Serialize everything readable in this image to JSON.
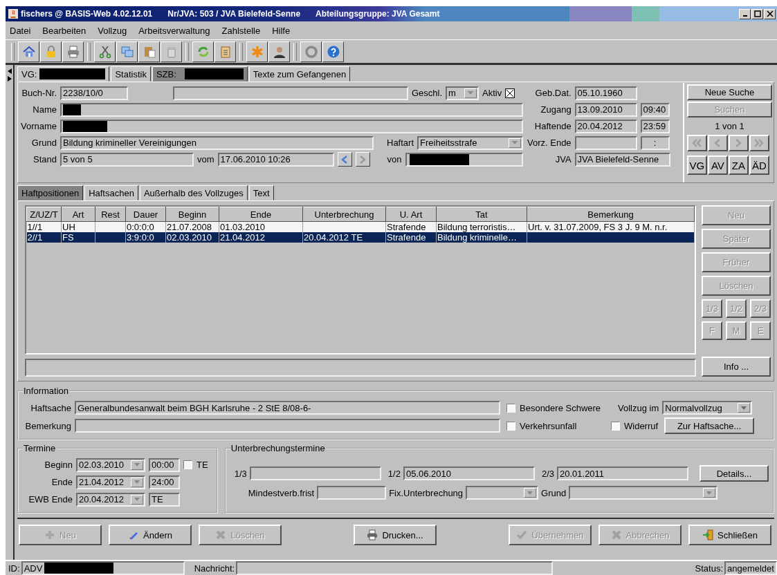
{
  "window": {
    "title_parts": [
      "fischers @ BASIS-Web 4.02.12.01",
      "Nr/JVA: 503 / JVA Bielefeld-Senne",
      "Abteilungsgruppe: JVA Gesamt"
    ]
  },
  "menu": [
    "Datei",
    "Bearbeiten",
    "Vollzug",
    "Arbeitsverwaltung",
    "Zahlstelle",
    "Hilfe"
  ],
  "record_tabs": [
    {
      "label": "VG:",
      "redacted": true,
      "selected": false
    },
    {
      "label": "Statistik",
      "selected": false
    },
    {
      "label": "SZB:",
      "redacted": true,
      "selected": true
    },
    {
      "label": "Texte zum Gefangenen",
      "selected": false
    }
  ],
  "header": {
    "buch_nr": {
      "label": "Buch-Nr.",
      "value": "2238/10/0"
    },
    "geschl": {
      "label": "Geschl.",
      "value": "m"
    },
    "aktiv": {
      "label": "Aktiv",
      "checked": true
    },
    "name": {
      "label": "Name",
      "redacted": true
    },
    "vorname": {
      "label": "Vorname",
      "redacted": true
    },
    "grund": {
      "label": "Grund",
      "value": "Bildung krimineller Vereinigungen"
    },
    "haftart": {
      "label": "Haftart",
      "value": "Freiheitsstrafe"
    },
    "stand": {
      "label": "Stand",
      "value": "5 von 5"
    },
    "vom": {
      "label": "vom",
      "value": "17.06.2010 10:26"
    },
    "von": {
      "label": "von",
      "redacted": true
    },
    "geb_dat": {
      "label": "Geb.Dat.",
      "value": "05.10.1960"
    },
    "zugang": {
      "label": "Zugang",
      "value": "13.09.2010",
      "time": "09:40"
    },
    "haftende": {
      "label": "Haftende",
      "value": "20.04.2012",
      "time": "23:59"
    },
    "vorz_ende": {
      "label": "Vorz. Ende",
      "time": ":"
    },
    "jva": {
      "label": "JVA",
      "value": "JVA Bielefeld-Senne"
    }
  },
  "search": {
    "buttons": [
      {
        "label": "Neue Suche",
        "disabled": false
      },
      {
        "label": "Suchen",
        "disabled": true
      }
    ],
    "counter": "1 von 1",
    "nav_disabled": true,
    "views": [
      "VG",
      "AV",
      "ZA",
      "ÄD"
    ]
  },
  "detail_tabs": [
    {
      "label": "Haftpositionen",
      "selected": true
    },
    {
      "label": "Haftsachen",
      "selected": false
    },
    {
      "label": "Außerhalb des Vollzuges",
      "selected": false
    },
    {
      "label": "Text",
      "selected": false
    }
  ],
  "table": {
    "columns": [
      "Z/UZ/T",
      "Art",
      "Rest",
      "Dauer",
      "Beginn",
      "Ende",
      "Unterbrechung",
      "U. Art",
      "Tat",
      "Bemerkung"
    ],
    "rows": [
      {
        "selected": false,
        "cells": [
          "1//1",
          "UH",
          null,
          "0:0:0:0",
          "21.07.2008",
          "01.03.2010",
          null,
          "Strafende",
          "Bildung terroristis…",
          "Urt. v. 31.07.2009, FS 3 J. 9 M. n.r."
        ]
      },
      {
        "selected": true,
        "cells": [
          "2//1",
          "FS",
          null,
          "3:9:0:0",
          "02.03.2010",
          "21.04.2012",
          "20.04.2012 TE",
          "Strafende",
          "Bildung kriminelle…",
          null
        ]
      }
    ]
  },
  "side_buttons": [
    {
      "label": "Neu",
      "disabled": true
    },
    {
      "label": "Später",
      "disabled": true
    },
    {
      "label": "Früher",
      "disabled": true
    },
    {
      "label": "Löschen",
      "disabled": true
    }
  ],
  "fraction_buttons": [
    {
      "label": "1/3",
      "disabled": true
    },
    {
      "label": "1/2",
      "disabled": true
    },
    {
      "label": "2/3",
      "disabled": true
    }
  ],
  "letter_buttons": [
    {
      "label": "F",
      "disabled": true
    },
    {
      "label": "M",
      "disabled": true
    },
    {
      "label": "E",
      "disabled": true
    }
  ],
  "info_button": "Info ...",
  "information": {
    "title": "Information",
    "haftsache": {
      "label": "Haftsache",
      "value": "Generalbundesanwalt beim BGH Karlsruhe - 2 StE 8/08-6-"
    },
    "bemerkung": {
      "label": "Bemerkung"
    },
    "besondere": {
      "label": "Besondere Schwere",
      "checked": false
    },
    "verkehr": {
      "label": "Verkehrsunfall",
      "checked": false
    },
    "widerruf": {
      "label": "Widerruf",
      "checked": false
    },
    "vollzug": {
      "label": "Vollzug im",
      "value": "Normalvollzug"
    },
    "button": "Zur Haftsache..."
  },
  "termine": {
    "title": "Termine",
    "rows": [
      {
        "label": "Beginn",
        "date": "02.03.2010",
        "time": "00:00"
      },
      {
        "label": "Ende",
        "date": "21.04.2012",
        "time": "24:00"
      },
      {
        "label": "EWB Ende",
        "date": "20.04.2012",
        "time": "TE"
      }
    ],
    "te": {
      "label": "TE",
      "checked": false
    }
  },
  "unterbrechung": {
    "title": "Unterbrechungstermine",
    "fractions": [
      {
        "label": "1/3"
      },
      {
        "label": "1/2",
        "value": "05.06.2010"
      },
      {
        "label": "2/3",
        "value": "20.01.2011"
      }
    ],
    "details": "Details...",
    "mindest": {
      "label": "Mindestverb.frist"
    },
    "fix": {
      "label": "Fix.Unterbrechung"
    },
    "grund": {
      "label": "Grund"
    }
  },
  "actions": [
    {
      "label": "Neu",
      "kind": "add",
      "disabled": true
    },
    {
      "label": "Ändern",
      "kind": "edit",
      "disabled": false
    },
    {
      "label": "Löschen",
      "kind": "delete",
      "disabled": true
    },
    {
      "label": "Drucken...",
      "kind": "print",
      "disabled": false
    },
    {
      "label": "Übernehmen",
      "kind": "confirm",
      "disabled": true
    },
    {
      "label": "Abbrechen",
      "kind": "cancel",
      "disabled": true
    },
    {
      "label": "Schließen",
      "kind": "exit",
      "disabled": false
    }
  ],
  "status_bar": {
    "id": {
      "label": "ID:",
      "value": "ADV",
      "redacted": true
    },
    "nachricht": {
      "label": "Nachricht:"
    },
    "status": {
      "label": "Status:",
      "value": "angemeldet"
    }
  }
}
